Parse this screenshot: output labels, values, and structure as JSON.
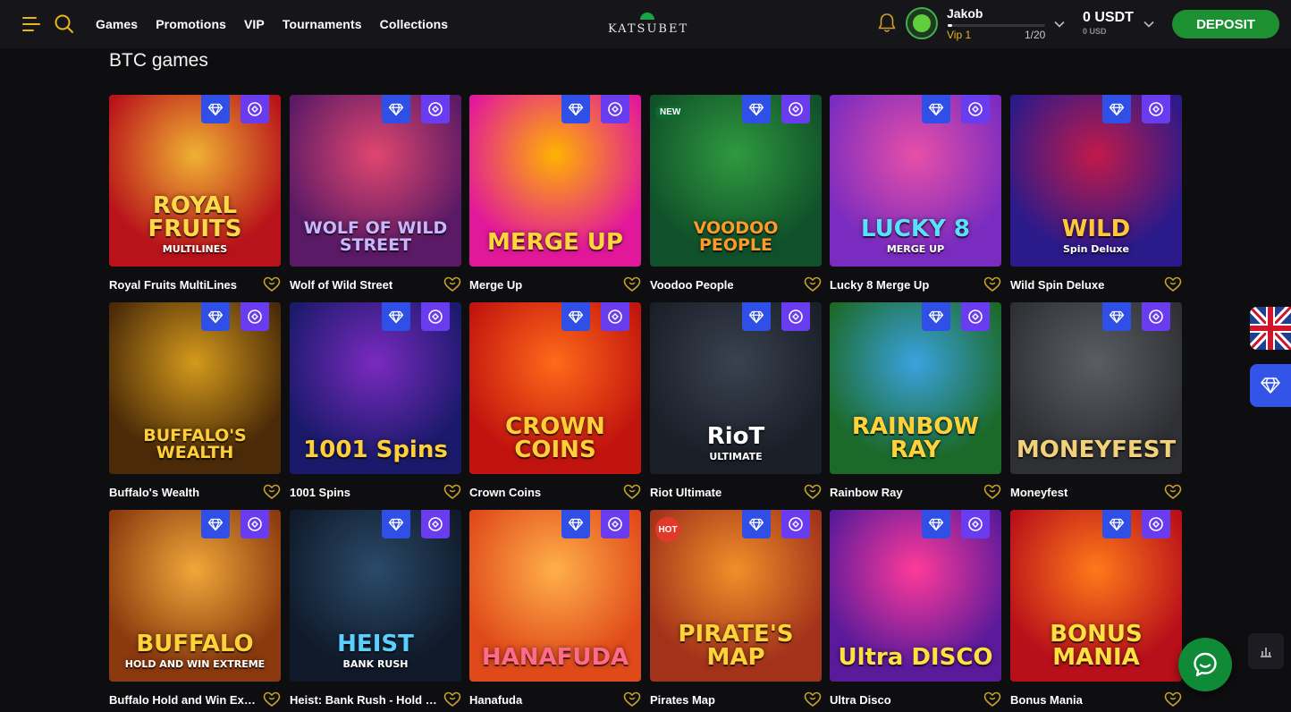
{
  "header": {
    "nav": [
      "Games",
      "Promotions",
      "VIP",
      "Tournaments",
      "Collections"
    ],
    "logo_text": "KATSUBET",
    "user": {
      "name": "Jakob",
      "vip_level": "Vip 1",
      "vip_progress_text": "1/20",
      "vip_progress_fraction": 0.05
    },
    "balance": {
      "amount": "0 USDT",
      "converted": "0 USD"
    },
    "deposit_label": "DEPOSIT"
  },
  "section": {
    "title": "BTC games",
    "games": [
      {
        "name": "Royal Fruits MultiLines",
        "art_title": "ROYAL FRUITS",
        "art_sub": "MULTILINES",
        "bg": "#b8131a",
        "bg2": "#f0b233",
        "fg": "#ffd84a",
        "tag": ""
      },
      {
        "name": "Wolf of Wild Street",
        "art_title": "WOLF OF WILD STREET",
        "art_sub": "",
        "bg": "#5a1a66",
        "bg2": "#e0466e",
        "fg": "#c9b6ff",
        "tag": ""
      },
      {
        "name": "Merge Up",
        "art_title": "MERGE UP",
        "art_sub": "",
        "bg": "#e2189a",
        "bg2": "#ffb300",
        "fg": "#ffd53a",
        "tag": ""
      },
      {
        "name": "Voodoo People",
        "art_title": "VOODOO PEOPLE",
        "art_sub": "",
        "bg": "#10502a",
        "bg2": "#2f9a3f",
        "fg": "#ff9a2a",
        "tag": "NEW"
      },
      {
        "name": "Lucky 8 Merge Up",
        "art_title": "LUCKY 8",
        "art_sub": "MERGE UP",
        "bg": "#7a2cc0",
        "bg2": "#e84fa7",
        "fg": "#5ae0ff",
        "tag": ""
      },
      {
        "name": "Wild Spin Deluxe",
        "art_title": "WILD",
        "art_sub": "Spin Deluxe",
        "bg": "#2a1a8a",
        "bg2": "#c11a4a",
        "fg": "#ffc83a",
        "tag": ""
      },
      {
        "name": "Buffalo's Wealth",
        "art_title": "BUFFALO'S WEALTH",
        "art_sub": "",
        "bg": "#4a2a08",
        "bg2": "#d49a1c",
        "fg": "#ffcf3a",
        "tag": ""
      },
      {
        "name": "1001 Spins",
        "art_title": "1001 Spins",
        "art_sub": "",
        "bg": "#1a1a6a",
        "bg2": "#7a2ac0",
        "fg": "#ffcf3a",
        "tag": ""
      },
      {
        "name": "Crown Coins",
        "art_title": "CROWN COINS",
        "art_sub": "",
        "bg": "#c2140e",
        "bg2": "#ff6a1a",
        "fg": "#ffcf3a",
        "tag": ""
      },
      {
        "name": "Riot Ultimate",
        "art_title": "RioT",
        "art_sub": "ULTIMATE",
        "bg": "#1a1f28",
        "bg2": "#3a4250",
        "fg": "#ffffff",
        "tag": ""
      },
      {
        "name": "Rainbow Ray",
        "art_title": "RAINBOW RAY",
        "art_sub": "",
        "bg": "#1c6a2a",
        "bg2": "#3aa2e0",
        "fg": "#ffd23a",
        "tag": ""
      },
      {
        "name": "Moneyfest",
        "art_title": "MONEYFEST",
        "art_sub": "",
        "bg": "#2e3034",
        "bg2": "#5a5e64",
        "fg": "#f2d17a",
        "tag": ""
      },
      {
        "name": "Buffalo Hold and Win Extreme",
        "art_title": "BUFFALO",
        "art_sub": "HOLD AND WIN EXTREME",
        "bg": "#8a3a0e",
        "bg2": "#f0a83a",
        "fg": "#ffd23a",
        "tag": ""
      },
      {
        "name": "Heist: Bank Rush - Hold & Win",
        "art_title": "HEIST",
        "art_sub": "BANK RUSH",
        "bg": "#101a2a",
        "bg2": "#2a4a6a",
        "fg": "#5ad0ff",
        "tag": ""
      },
      {
        "name": "Hanafuda",
        "art_title": "HANAFUDA",
        "art_sub": "",
        "bg": "#e04a1a",
        "bg2": "#ffb04a",
        "fg": "#ff6a8a",
        "tag": ""
      },
      {
        "name": "Pirates Map",
        "art_title": "PIRATE'S MAP",
        "art_sub": "",
        "bg": "#a2321a",
        "bg2": "#f0902a",
        "fg": "#ffd23a",
        "tag": "HOT"
      },
      {
        "name": "Ultra Disco",
        "art_title": "Ultra DISCO",
        "art_sub": "",
        "bg": "#5a1a9a",
        "bg2": "#ff3a9a",
        "fg": "#ffe040",
        "tag": ""
      },
      {
        "name": "Bonus Mania",
        "art_title": "BONUS MANIA",
        "art_sub": "",
        "bg": "#b8101a",
        "bg2": "#ff7a1a",
        "fg": "#ffe040",
        "tag": ""
      }
    ]
  },
  "colors": {
    "accent_green": "#1d9132",
    "vip_gold": "#e8b51c",
    "badge_blue": "#2f4fe6",
    "badge_purple": "#6a3cf0"
  }
}
